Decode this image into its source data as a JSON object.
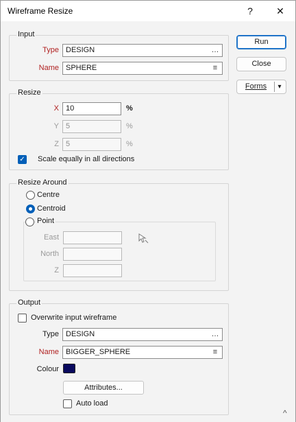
{
  "window": {
    "title": "Wireframe Resize",
    "help_icon": "?",
    "close_icon": "✕"
  },
  "actions": {
    "run": "Run",
    "close": "Close",
    "forms": "Forms",
    "forms_arrow": "▾"
  },
  "input": {
    "group_title": "Input",
    "type_label": "Type",
    "type_value": "DESIGN",
    "type_icon": "…",
    "name_label": "Name",
    "name_value": "SPHERE",
    "name_icon": "≡"
  },
  "resize": {
    "group_title": "Resize",
    "x_label": "X",
    "x_value": "10",
    "x_unit": "%",
    "y_label": "Y",
    "y_value": "5",
    "y_unit": "%",
    "z_label": "Z",
    "z_value": "5",
    "z_unit": "%",
    "scale_equally_label": "Scale equally in all directions",
    "scale_equally_checked": true
  },
  "resize_around": {
    "group_title": "Resize Around",
    "options": [
      "Centre",
      "Centroid",
      "Point"
    ],
    "selected": "Centroid",
    "east_label": "East",
    "north_label": "North",
    "z_label": "Z",
    "east_value": "",
    "north_value": "",
    "z_value": ""
  },
  "output": {
    "group_title": "Output",
    "overwrite_label": "Overwrite input wireframe",
    "overwrite_checked": false,
    "type_label": "Type",
    "type_value": "DESIGN",
    "type_icon": "…",
    "name_label": "Name",
    "name_value": "BIGGER_SPHERE",
    "name_icon": "≡",
    "colour_label": "Colour",
    "colour_value": "#0a0a5e",
    "attributes_label": "Attributes...",
    "auto_load_label": "Auto load",
    "auto_load_checked": false
  },
  "footer": {
    "collapse_icon": "^"
  }
}
